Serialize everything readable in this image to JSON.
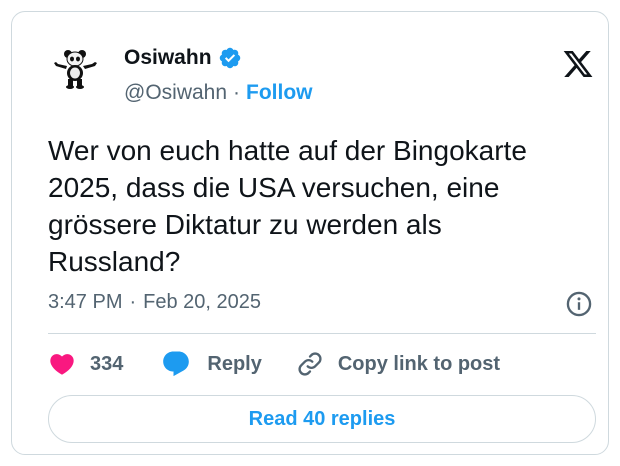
{
  "author": {
    "name": "Osiwahn",
    "handle": "@Osiwahn",
    "separator": "·",
    "follow_label": "Follow",
    "verified_icon": "verified-badge-icon",
    "avatar_icon": "panda-avatar"
  },
  "tweet": {
    "text": "Wer von euch hatte auf der Bingokarte\n2025, dass die USA versuchen, eine\ngrössere Diktatur zu werden als\nRussland?",
    "time": "3:47 PM",
    "separator": "·",
    "date": "Feb 20, 2025"
  },
  "actions": {
    "like_count": "334",
    "reply_label": "Reply",
    "copy_label": "Copy link to post"
  },
  "read_replies_label": "Read 40 replies",
  "colors": {
    "accent": "#1d9bf0",
    "like": "#f91880",
    "text": "#0f1419",
    "muted": "#536471",
    "border": "#cfd9de"
  }
}
